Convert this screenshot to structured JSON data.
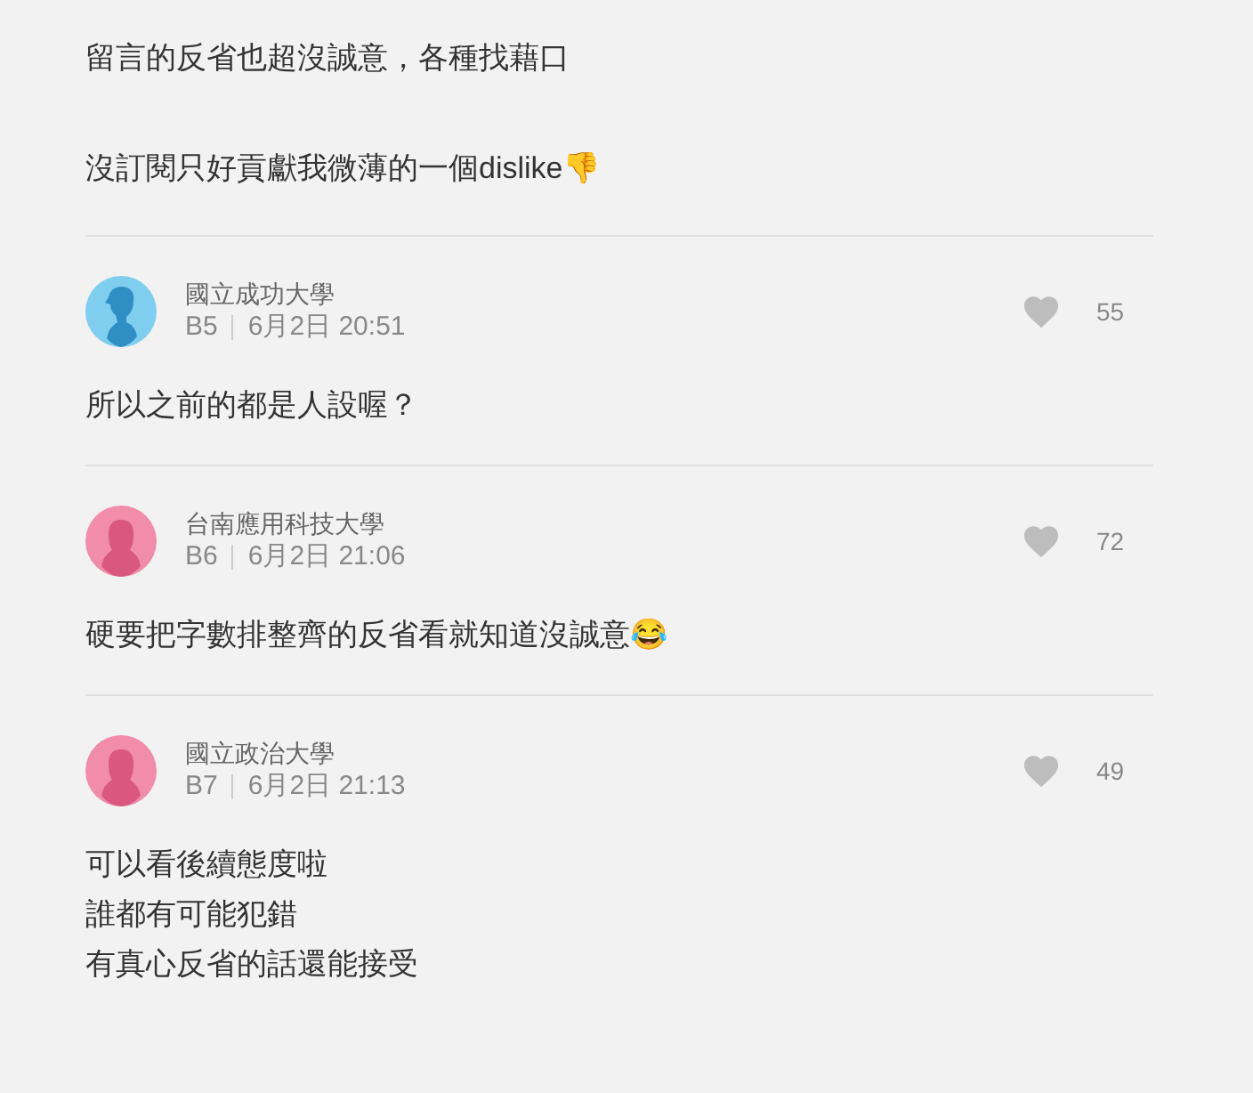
{
  "post_tail": {
    "paragraphs": [
      "留言的反省也超沒誠意，各種找藉口",
      "沒訂閱只好貢獻我微薄的一個dislike👎"
    ]
  },
  "comments": [
    {
      "avatar": {
        "kind": "male"
      },
      "school": "國立成功大學",
      "floor": "B5",
      "time": "6月2日 20:51",
      "likes": "55",
      "lines": [
        "所以之前的都是人設喔？"
      ]
    },
    {
      "avatar": {
        "kind": "female"
      },
      "school": "台南應用科技大學",
      "floor": "B6",
      "time": "6月2日 21:06",
      "likes": "72",
      "lines": [
        "硬要把字數排整齊的反省看就知道沒誠意😂"
      ]
    },
    {
      "avatar": {
        "kind": "female"
      },
      "school": "國立政治大學",
      "floor": "B7",
      "time": "6月2日 21:13",
      "likes": "49",
      "lines": [
        "可以看後續態度啦",
        "誰都有可能犯錯",
        "有真心反省的話還能接受"
      ]
    }
  ]
}
